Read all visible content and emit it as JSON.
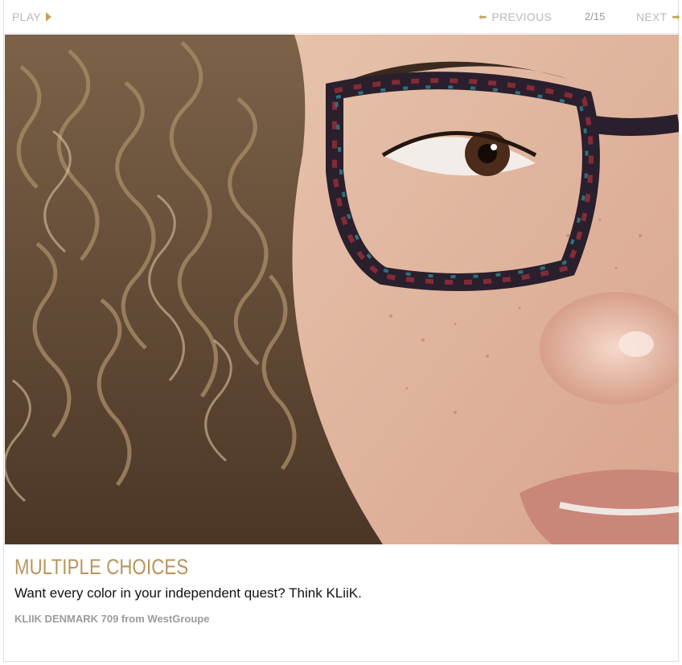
{
  "nav": {
    "play_label": "PLAY",
    "previous_label": "PREVIOUS",
    "counter": "2/15",
    "next_label": "NEXT",
    "accent_color": "#c7a45c"
  },
  "slide": {
    "title": "MULTIPLE CHOICES",
    "subtitle": "Want every color in your independent quest? Think KLiiK.",
    "credit": "KLIIK DENMARK 709 from WestGroupe"
  },
  "colors": {
    "title": "#b9935a",
    "subtitle": "#111111",
    "credit": "#9b9b9b"
  }
}
